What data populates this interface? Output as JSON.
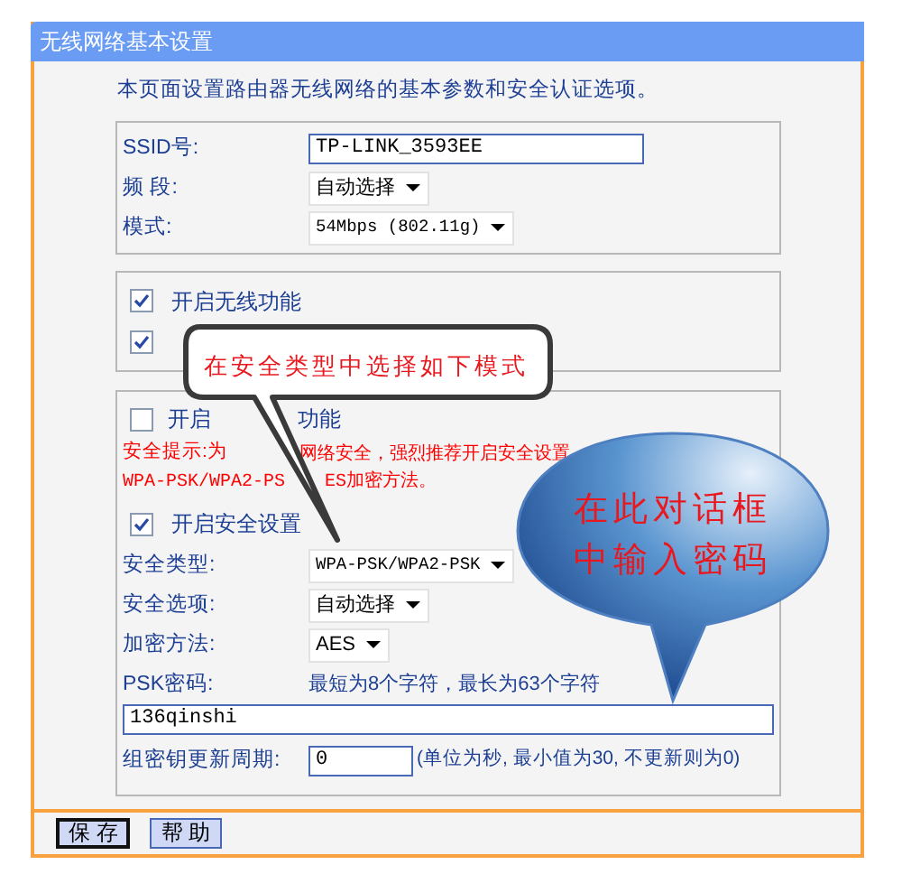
{
  "window": {
    "title": "无线网络基本设置"
  },
  "intro": "本页面设置路由器无线网络的基本参数和安全认证选项。",
  "basic_fields": [
    {
      "label": "SSID号:",
      "kind": "text",
      "value": "TP-LINK_3593EE"
    },
    {
      "label": "频 段:",
      "kind": "select",
      "value": "自动选择"
    },
    {
      "label": "模式:",
      "kind": "select",
      "value": "54Mbps (802.11g)"
    }
  ],
  "options": [
    {
      "label": "开启无线功能",
      "checked": true
    },
    {
      "checked": true
    }
  ],
  "wds": {
    "label_parts": [
      "开启",
      "功能"
    ],
    "checked": false
  },
  "security_hint": {
    "line_1": [
      "安全提示:为",
      "网络安全，强烈推荐开启安全设置"
    ],
    "line_2": [
      "WPA-PSK/WPA2-PS",
      "ES加密方法。"
    ]
  },
  "security": {
    "label": "开启安全设置",
    "checked": true
  },
  "security_fields": [
    {
      "label": "安全类型:",
      "kind": "select",
      "value": "WPA-PSK/WPA2-PSK"
    },
    {
      "label": "安全选项:",
      "kind": "select",
      "value": "自动选择"
    },
    {
      "label": "加密方法:",
      "kind": "select",
      "value": "AES"
    }
  ],
  "psk": {
    "label": "PSK密码:",
    "hint": "最短为8个字符，最长为63个字符",
    "value": "136qinshi"
  },
  "group_key": {
    "label": "组密钥更新周期:",
    "value": "0",
    "note": "(单位为秒, 最小值为30, 不更新则为0)"
  },
  "buttons": [
    {
      "label": "保 存",
      "selected": true
    },
    {
      "label": "帮 助",
      "selected": false
    }
  ],
  "callouts": [
    {
      "kind": "box",
      "lines": [
        "在安全类型中选择如下模式"
      ]
    },
    {
      "kind": "bubble",
      "lines": [
        "在此对话框",
        "中输入密码"
      ]
    }
  ]
}
